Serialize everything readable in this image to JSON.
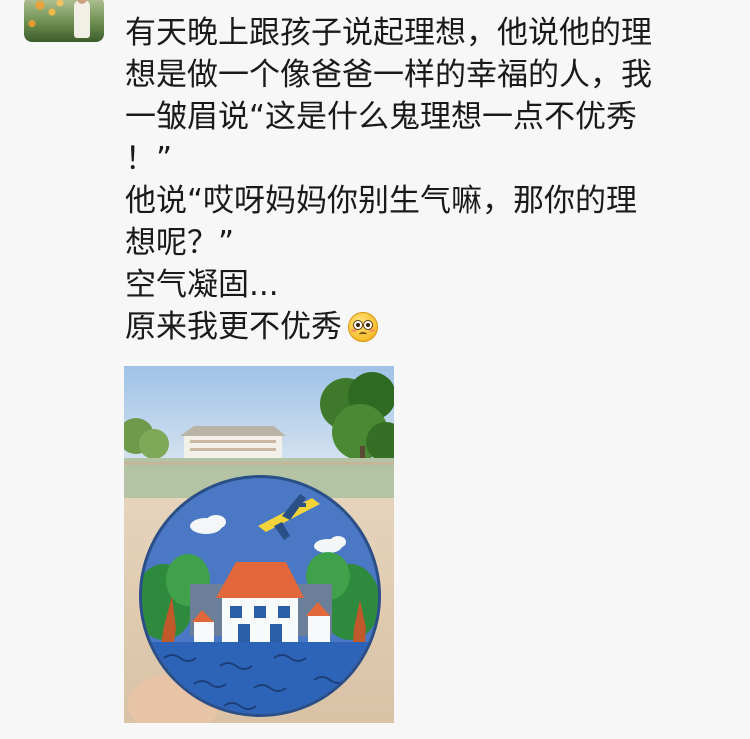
{
  "post": {
    "text_lines": [
      "有天晚上跟孩子说起理想，他说他的理",
      "想是做一个像爸爸一样的幸福的人，我",
      "一皱眉说“这是什么鬼理想一点不优秀",
      "！”",
      "他说“哎呀妈妈你别生气嘛，那你的理",
      "想呢？”",
      "空气凝固...",
      "原来我更不优秀"
    ],
    "emoji": "flushed-face-icon"
  },
  "colors": {
    "background": "#f7f7f7",
    "text": "#1a1a1a"
  }
}
